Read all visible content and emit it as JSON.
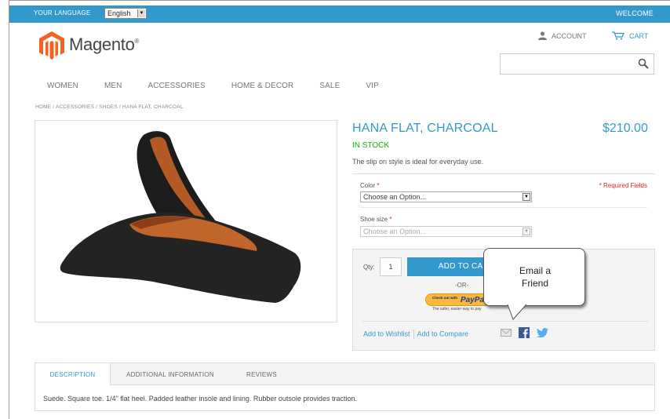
{
  "header": {
    "language_label": "YOUR LANGUAGE",
    "language_value": "English",
    "welcome": "WELCOME",
    "logo_text": "Magento",
    "logo_mark": "®",
    "account": "ACCOUNT",
    "cart": "CART",
    "search_placeholder": ""
  },
  "nav": {
    "items": [
      {
        "label": "WOMEN"
      },
      {
        "label": "MEN"
      },
      {
        "label": "ACCESSORIES"
      },
      {
        "label": "HOME & DECOR"
      },
      {
        "label": "SALE"
      },
      {
        "label": "VIP"
      }
    ]
  },
  "breadcrumb": "HOME / ACCESSORIES / SHOES / HANA FLAT, CHARCOAL",
  "product": {
    "name": "HANA FLAT, CHARCOAL",
    "price": "$210.00",
    "availability": "IN STOCK",
    "short_description": "The slip on style is ideal for everyday use.",
    "required_note": "* Required Fields",
    "options": {
      "color_label": "Color",
      "color_value": "Choose an Option...",
      "size_label": "Shoe size",
      "size_value": "Choose an Option...",
      "required_mark": "*"
    },
    "qty_label": "Qty:",
    "qty_value": "1",
    "add_to_cart": "ADD TO CART",
    "or": "-OR-",
    "paypal_checkout": "Check out with",
    "paypal_brand": "PayPal",
    "paypal_tagline": "The safer, easier way to pay",
    "add_to_wishlist": "Add to Wishlist",
    "add_to_compare": "Add to Compare"
  },
  "callout": {
    "line1": "Email a",
    "line2": "Friend"
  },
  "tabs": {
    "items": [
      {
        "label": "DESCRIPTION"
      },
      {
        "label": "ADDITIONAL INFORMATION"
      },
      {
        "label": "REVIEWS"
      }
    ],
    "content": "Suede. Square toe. 1/4\" flat heel. Padded leather insole and lining. Rubber outsole provides traction."
  },
  "colors": {
    "accent": "#3399cc",
    "in_stock": "#11b400",
    "required": "#df280a",
    "logo_orange": "#f26322"
  },
  "icons": [
    "user-icon",
    "cart-icon",
    "search-icon",
    "email-icon",
    "facebook-icon",
    "twitter-icon"
  ]
}
